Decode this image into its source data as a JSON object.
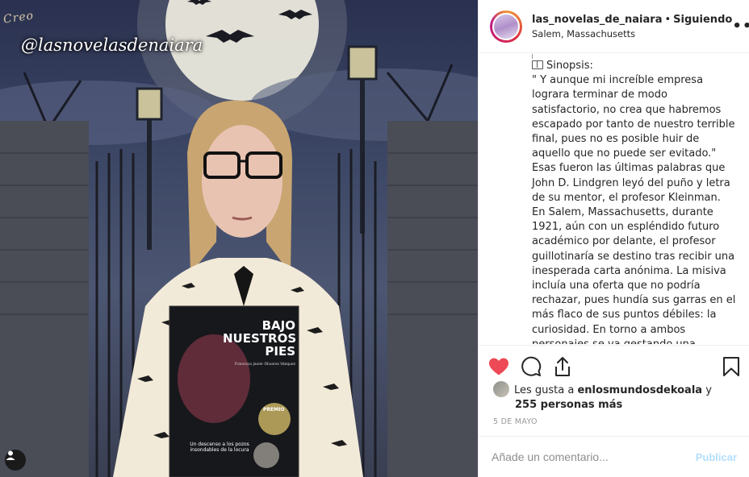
{
  "photo": {
    "watermark_small": "Creo",
    "watermark_main": "@lasnovelasdenaiara",
    "book_title": "BAJO NUESTROS PIES",
    "book_author": "Francisco Javier Olivares Vázquez",
    "book_tagline": "Un descenso a los pozos insondables de la locura",
    "book_award": "PREMIO",
    "tag_icon": "user-tag-icon"
  },
  "header": {
    "username": "las_novelas_de_naiara",
    "separator": "•",
    "follow_status": "Siguiendo",
    "location": "Salem, Massachusetts",
    "more_icon": "more-options-icon"
  },
  "caption": {
    "heading": "Sinopsis:",
    "body": "\" Y aunque mi increíble empresa lograra terminar de modo satisfactorio, no crea que habremos escapado por tanto de nuestro terrible final, pues no es posible huir de aquello que no puede ser evitado.\"\nEsas fueron las últimas palabras que John D. Lindgren leyó del puño y letra de su mentor, el profesor Kleinman. En Salem, Massachusetts, durante 1921, aún con un espléndido futuro académico por delante, el profesor guillotinaría se destino tras recibir una inesperada carta anónima. La misiva incluía una oferta que no podría rechazar, pues hundía sus garras en el más flaco de sus puntos débiles: la curiosidad. En torno a ambos personajes se va gestando una historia"
  },
  "actions": {
    "like_icon": "heart-icon",
    "comment_icon": "comment-icon",
    "share_icon": "share-icon",
    "save_icon": "bookmark-icon",
    "like_color": "#ed4956"
  },
  "likes": {
    "prefix": "Les gusta a",
    "user": "enlosmundosdekoala",
    "conjunction": "y",
    "others": "255 personas más"
  },
  "date": "5 DE MAYO",
  "comment": {
    "placeholder": "Añade un comentario...",
    "publish": "Publicar"
  }
}
